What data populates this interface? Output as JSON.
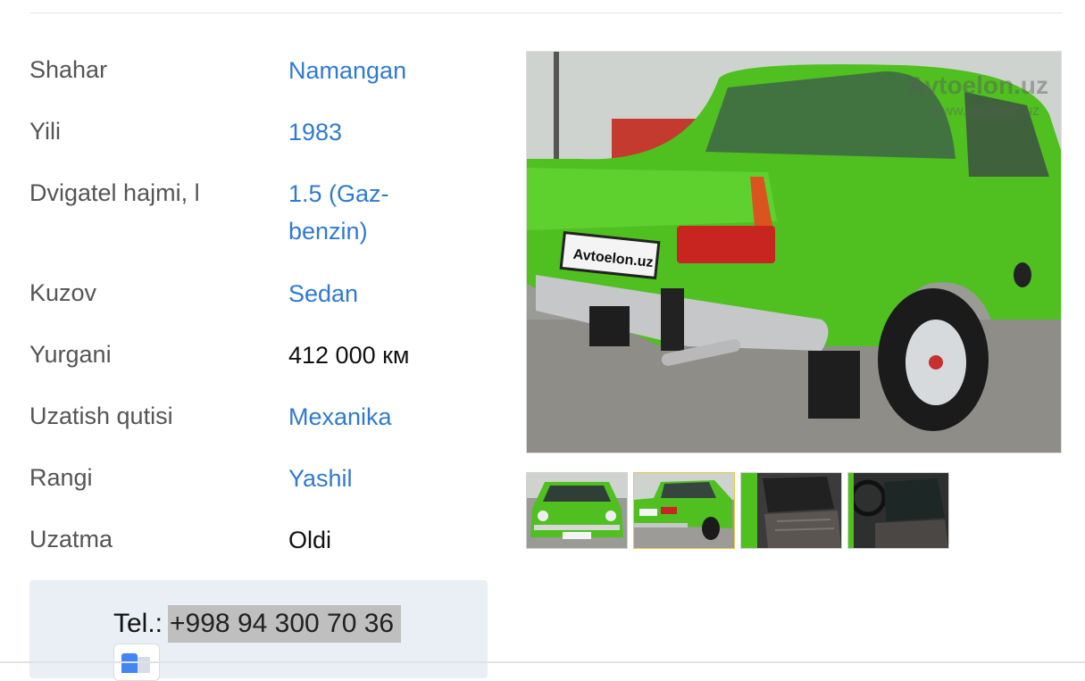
{
  "specs": [
    {
      "label": "Shahar",
      "value": "Namangan",
      "link": true
    },
    {
      "label": "Yili",
      "value": "1983",
      "link": true
    },
    {
      "label": "Dvigatel hajmi, l",
      "value": "1.5 (Gaz-benzin)",
      "link": true
    },
    {
      "label": "Kuzov",
      "value": "Sedan",
      "link": true
    },
    {
      "label": "Yurgani",
      "value": "412 000 км",
      "link": false
    },
    {
      "label": "Uzatish qutisi",
      "value": "Mexanika",
      "link": true
    },
    {
      "label": "Rangi",
      "value": "Yashil",
      "link": true
    },
    {
      "label": "Uzatma",
      "value": "Oldi",
      "link": false
    }
  ],
  "contact": {
    "label": "Tel.:",
    "phone": "+998 94 300 70 36"
  },
  "gallery": {
    "watermark": "Avtoelon.uz",
    "watermark_sub": "www.avtoelon.uz",
    "plate": "Avtoelon.uz",
    "thumbnails": [
      "car-front",
      "car-rear",
      "interior-seat",
      "interior-dashboard"
    ],
    "active_index": 1
  },
  "colors": {
    "link": "#2f7ad0",
    "car": "#4fc020",
    "phone_bg": "#e9eff5"
  }
}
